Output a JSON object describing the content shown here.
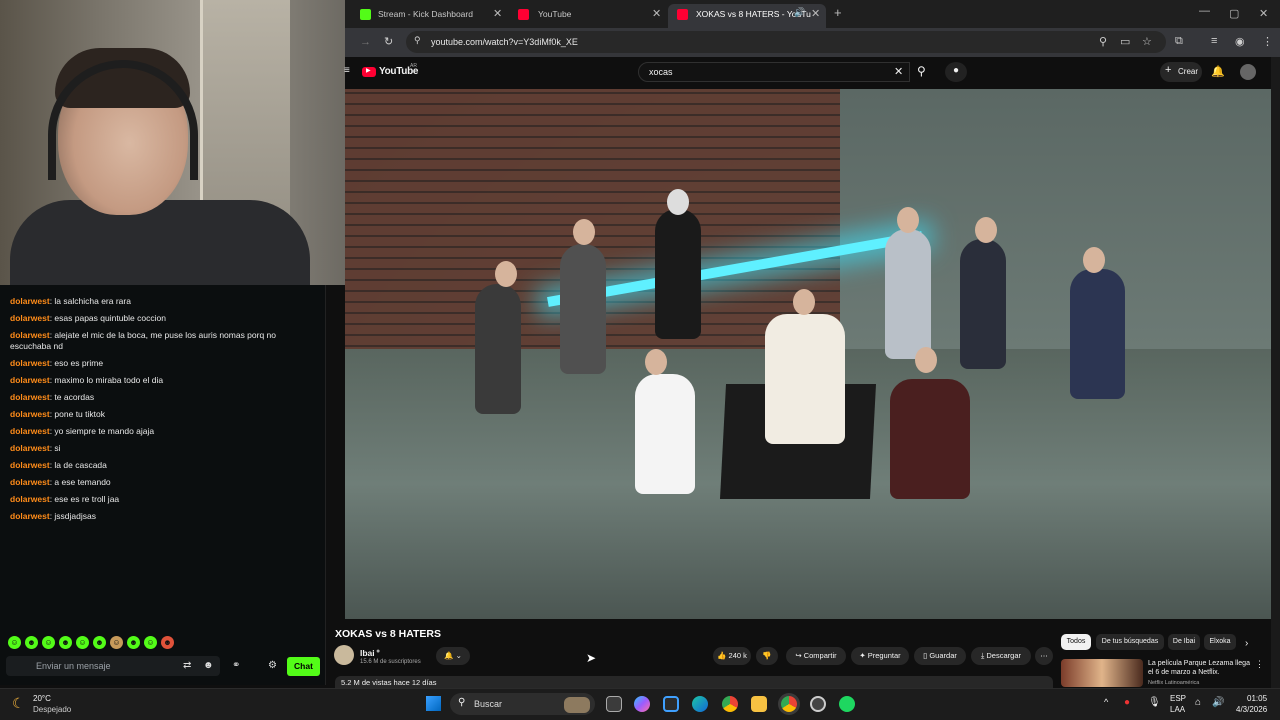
{
  "browser": {
    "tabs": [
      {
        "label": "Stream - Kick Dashboard",
        "active": false
      },
      {
        "label": "YouTube",
        "active": false
      },
      {
        "label": "XOKAS vs 8 HATERS - YouTu",
        "active": true
      }
    ],
    "url": "youtube.com/watch?v=Y3diMf0k_XE"
  },
  "youtube": {
    "logo": "YouTube",
    "logo_region": "AR",
    "search_value": "xocas",
    "create_label": "Crear",
    "video_title": "XOKAS vs 8 HATERS",
    "channel_name": "Ibai",
    "subscribers": "15.6 M de suscriptores",
    "likes": "240 k",
    "share_label": "Compartir",
    "ask_label": "Preguntar",
    "save_label": "Guardar",
    "download_label": "Descargar",
    "views_line": "5.2 M de vistas  hace 12 días",
    "chips": [
      "Todos",
      "De tus búsquedas",
      "De Ibai",
      "Elxoka"
    ],
    "rec_title": "La película Parque Lezama llega el 6 de marzo a Netflix.",
    "rec_channel": "Netflix Latinoamérica"
  },
  "chat": {
    "messages": [
      {
        "user": "dolarwest",
        "text": "la salchicha era rara"
      },
      {
        "user": "dolarwest",
        "text": "esas papas quintuble coccion"
      },
      {
        "user": "dolarwest",
        "text": "alejate el mic de la boca, me puse los auris nomas porq no escuchaba nd"
      },
      {
        "user": "dolarwest",
        "text": "eso es prime"
      },
      {
        "user": "dolarwest",
        "text": "maximo lo miraba todo el dia"
      },
      {
        "user": "dolarwest",
        "text": "te acordas"
      },
      {
        "user": "dolarwest",
        "text": "pone tu tiktok"
      },
      {
        "user": "dolarwest",
        "text": "yo siempre te mando ajaja"
      },
      {
        "user": "dolarwest",
        "text": "si"
      },
      {
        "user": "dolarwest",
        "text": "la de cascada"
      },
      {
        "user": "dolarwest",
        "text": "a ese temando"
      },
      {
        "user": "dolarwest",
        "text": "ese es re troll jaa"
      },
      {
        "user": "dolarwest",
        "text": "jssdjadjsas"
      }
    ],
    "input_placeholder": "Enviar un mensaje",
    "chat_button": "Chat"
  },
  "taskbar": {
    "temperature": "20°C",
    "weather": "Despejado",
    "search_placeholder": "Buscar",
    "lang": "ESP",
    "layout": "LAA",
    "time": "01:05",
    "date": "4/3/2026"
  },
  "colors": {
    "kick_green": "#53fc18",
    "yt_red": "#ff0033",
    "chat_user": "#ff8c1a"
  }
}
